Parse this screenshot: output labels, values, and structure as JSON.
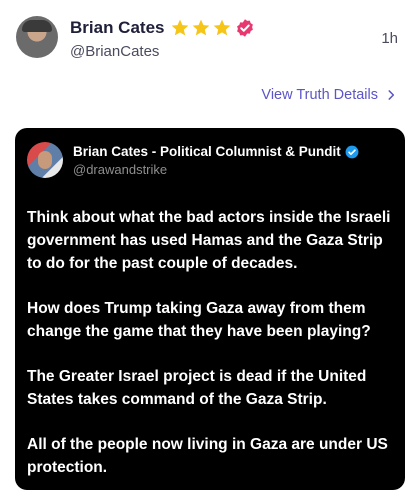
{
  "post": {
    "display_name": "Brian Cates",
    "handle": "@BrianCates",
    "time": "1h",
    "star_count": 3
  },
  "details_link": {
    "label": "View Truth Details"
  },
  "quote": {
    "name": "Brian Cates - Political Columnist & Pundit",
    "handle": "@drawandstrike",
    "paragraphs": [
      "Think about what the bad actors inside the Israeli government has used Hamas and the Gaza Strip to do for the past couple of decades.",
      "How does Trump taking Gaza away from them change the game that they have been playing?",
      "The Greater  Israel project is dead if the United States takes command of the Gaza Strip.",
      "All of the people now living in Gaza are under US protection."
    ]
  },
  "colors": {
    "star": "#f5c518",
    "verified_badge": "#e8386f",
    "link": "#5b55c8",
    "quote_bg": "#000000",
    "quote_verified": "#1d9bf0"
  }
}
